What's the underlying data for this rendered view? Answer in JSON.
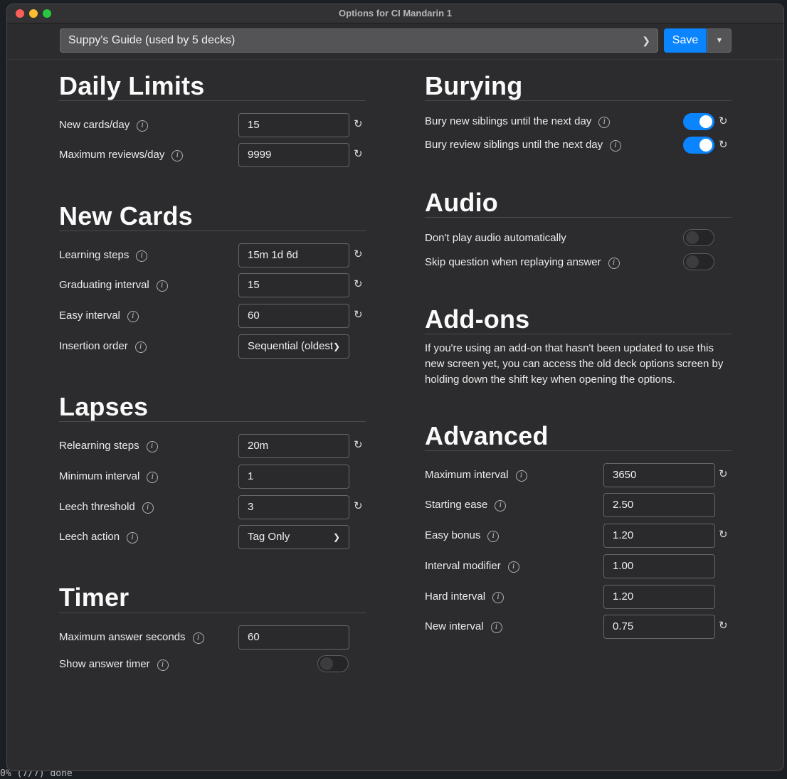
{
  "window": {
    "title": "Options for CI Mandarin 1"
  },
  "background": {
    "bottom_text": "0% (7/7)  done"
  },
  "toolbar": {
    "preset": "Suppy's Guide (used by 5 decks)",
    "save_label": "Save"
  },
  "daily_limits": {
    "title": "Daily Limits",
    "new_cards_label": "New cards/day",
    "new_cards_value": "15",
    "max_reviews_label": "Maximum reviews/day",
    "max_reviews_value": "9999"
  },
  "new_cards": {
    "title": "New Cards",
    "learning_steps_label": "Learning steps",
    "learning_steps_value": "15m 1d 6d",
    "graduating_label": "Graduating interval",
    "graduating_value": "15",
    "easy_label": "Easy interval",
    "easy_value": "60",
    "insertion_label": "Insertion order",
    "insertion_value": "Sequential (oldest"
  },
  "lapses": {
    "title": "Lapses",
    "relearning_label": "Relearning steps",
    "relearning_value": "20m",
    "min_interval_label": "Minimum interval",
    "min_interval_value": "1",
    "leech_threshold_label": "Leech threshold",
    "leech_threshold_value": "3",
    "leech_action_label": "Leech action",
    "leech_action_value": "Tag Only"
  },
  "timer": {
    "title": "Timer",
    "max_answer_label": "Maximum answer seconds",
    "max_answer_value": "60",
    "show_timer_label": "Show answer timer",
    "show_timer_on": false
  },
  "burying": {
    "title": "Burying",
    "bury_new_label": "Bury new siblings until the next day",
    "bury_new_on": true,
    "bury_review_label": "Bury review siblings until the next day",
    "bury_review_on": true
  },
  "audio": {
    "title": "Audio",
    "no_autoplay_label": "Don't play audio automatically",
    "no_autoplay_on": false,
    "skip_question_label": "Skip question when replaying answer",
    "skip_question_on": false
  },
  "addons": {
    "title": "Add-ons",
    "text": "If you're using an add-on that hasn't been updated to use this new screen yet, you can access the old deck options screen by holding down the shift key when opening the options."
  },
  "advanced": {
    "title": "Advanced",
    "max_interval_label": "Maximum interval",
    "max_interval_value": "3650",
    "starting_ease_label": "Starting ease",
    "starting_ease_value": "2.50",
    "easy_bonus_label": "Easy bonus",
    "easy_bonus_value": "1.20",
    "interval_mod_label": "Interval modifier",
    "interval_mod_value": "1.00",
    "hard_interval_label": "Hard interval",
    "hard_interval_value": "1.20",
    "new_interval_label": "New interval",
    "new_interval_value": "0.75"
  },
  "icons": {
    "info": "i",
    "reset": "↻",
    "chevron": "⌄",
    "caret": "▼"
  },
  "colors": {
    "accent": "#0a84ff",
    "window_bg": "#2c2c2e"
  }
}
